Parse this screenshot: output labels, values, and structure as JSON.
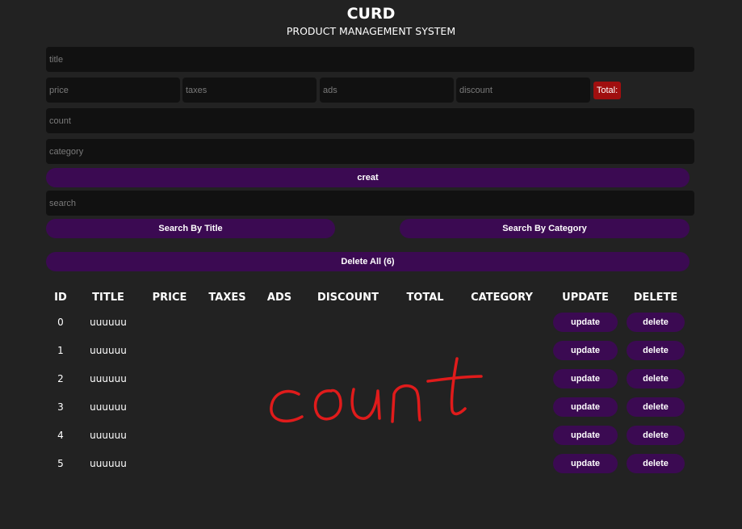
{
  "header": {
    "title": "CURD",
    "subtitle": "PRODUCT MANAGEMENT SYSTEM"
  },
  "form": {
    "title_placeholder": "title",
    "price_placeholder": "price",
    "taxes_placeholder": "taxes",
    "ads_placeholder": "ads",
    "discount_placeholder": "discount",
    "total_label": "Total:",
    "count_placeholder": "count",
    "category_placeholder": "category",
    "create_label": "creat"
  },
  "search": {
    "placeholder": "search",
    "by_title_label": "Search By Title",
    "by_category_label": "Search By Category"
  },
  "delete_all_label": "Delete All (6)",
  "table": {
    "headers": [
      "ID",
      "TITLE",
      "PRICE",
      "TAXES",
      "ADS",
      "DISCOUNT",
      "TOTAL",
      "CATEGORY",
      "UPDATE",
      "DELETE"
    ],
    "rows": [
      {
        "id": "0",
        "title": "uuuuuu",
        "update": "update",
        "delete": "delete"
      },
      {
        "id": "1",
        "title": "uuuuuu",
        "update": "update",
        "delete": "delete"
      },
      {
        "id": "2",
        "title": "uuuuuu",
        "update": "update",
        "delete": "delete"
      },
      {
        "id": "3",
        "title": "uuuuuu",
        "update": "update",
        "delete": "delete"
      },
      {
        "id": "4",
        "title": "uuuuuu",
        "update": "update",
        "delete": "delete"
      },
      {
        "id": "5",
        "title": "uuuuuu",
        "update": "update",
        "delete": "delete"
      }
    ]
  },
  "annotation": {
    "handwritten_text": "count",
    "color": "#e01b1b"
  },
  "colors": {
    "background": "#222222",
    "input": "#111111",
    "accent_purple": "#3b0a52",
    "total_red": "#a00f0f"
  }
}
